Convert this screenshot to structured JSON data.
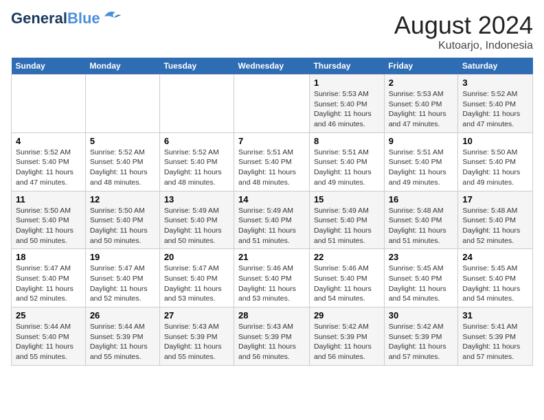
{
  "header": {
    "logo_line1": "General",
    "logo_line2": "Blue",
    "month_title": "August 2024",
    "location": "Kutoarjo, Indonesia"
  },
  "days_of_week": [
    "Sunday",
    "Monday",
    "Tuesday",
    "Wednesday",
    "Thursday",
    "Friday",
    "Saturday"
  ],
  "weeks": [
    [
      {
        "day": "",
        "info": ""
      },
      {
        "day": "",
        "info": ""
      },
      {
        "day": "",
        "info": ""
      },
      {
        "day": "",
        "info": ""
      },
      {
        "day": "1",
        "info": "Sunrise: 5:53 AM\nSunset: 5:40 PM\nDaylight: 11 hours and 46 minutes."
      },
      {
        "day": "2",
        "info": "Sunrise: 5:53 AM\nSunset: 5:40 PM\nDaylight: 11 hours and 47 minutes."
      },
      {
        "day": "3",
        "info": "Sunrise: 5:52 AM\nSunset: 5:40 PM\nDaylight: 11 hours and 47 minutes."
      }
    ],
    [
      {
        "day": "4",
        "info": "Sunrise: 5:52 AM\nSunset: 5:40 PM\nDaylight: 11 hours and 47 minutes."
      },
      {
        "day": "5",
        "info": "Sunrise: 5:52 AM\nSunset: 5:40 PM\nDaylight: 11 hours and 48 minutes."
      },
      {
        "day": "6",
        "info": "Sunrise: 5:52 AM\nSunset: 5:40 PM\nDaylight: 11 hours and 48 minutes."
      },
      {
        "day": "7",
        "info": "Sunrise: 5:51 AM\nSunset: 5:40 PM\nDaylight: 11 hours and 48 minutes."
      },
      {
        "day": "8",
        "info": "Sunrise: 5:51 AM\nSunset: 5:40 PM\nDaylight: 11 hours and 49 minutes."
      },
      {
        "day": "9",
        "info": "Sunrise: 5:51 AM\nSunset: 5:40 PM\nDaylight: 11 hours and 49 minutes."
      },
      {
        "day": "10",
        "info": "Sunrise: 5:50 AM\nSunset: 5:40 PM\nDaylight: 11 hours and 49 minutes."
      }
    ],
    [
      {
        "day": "11",
        "info": "Sunrise: 5:50 AM\nSunset: 5:40 PM\nDaylight: 11 hours and 50 minutes."
      },
      {
        "day": "12",
        "info": "Sunrise: 5:50 AM\nSunset: 5:40 PM\nDaylight: 11 hours and 50 minutes."
      },
      {
        "day": "13",
        "info": "Sunrise: 5:49 AM\nSunset: 5:40 PM\nDaylight: 11 hours and 50 minutes."
      },
      {
        "day": "14",
        "info": "Sunrise: 5:49 AM\nSunset: 5:40 PM\nDaylight: 11 hours and 51 minutes."
      },
      {
        "day": "15",
        "info": "Sunrise: 5:49 AM\nSunset: 5:40 PM\nDaylight: 11 hours and 51 minutes."
      },
      {
        "day": "16",
        "info": "Sunrise: 5:48 AM\nSunset: 5:40 PM\nDaylight: 11 hours and 51 minutes."
      },
      {
        "day": "17",
        "info": "Sunrise: 5:48 AM\nSunset: 5:40 PM\nDaylight: 11 hours and 52 minutes."
      }
    ],
    [
      {
        "day": "18",
        "info": "Sunrise: 5:47 AM\nSunset: 5:40 PM\nDaylight: 11 hours and 52 minutes."
      },
      {
        "day": "19",
        "info": "Sunrise: 5:47 AM\nSunset: 5:40 PM\nDaylight: 11 hours and 52 minutes."
      },
      {
        "day": "20",
        "info": "Sunrise: 5:47 AM\nSunset: 5:40 PM\nDaylight: 11 hours and 53 minutes."
      },
      {
        "day": "21",
        "info": "Sunrise: 5:46 AM\nSunset: 5:40 PM\nDaylight: 11 hours and 53 minutes."
      },
      {
        "day": "22",
        "info": "Sunrise: 5:46 AM\nSunset: 5:40 PM\nDaylight: 11 hours and 54 minutes."
      },
      {
        "day": "23",
        "info": "Sunrise: 5:45 AM\nSunset: 5:40 PM\nDaylight: 11 hours and 54 minutes."
      },
      {
        "day": "24",
        "info": "Sunrise: 5:45 AM\nSunset: 5:40 PM\nDaylight: 11 hours and 54 minutes."
      }
    ],
    [
      {
        "day": "25",
        "info": "Sunrise: 5:44 AM\nSunset: 5:40 PM\nDaylight: 11 hours and 55 minutes."
      },
      {
        "day": "26",
        "info": "Sunrise: 5:44 AM\nSunset: 5:39 PM\nDaylight: 11 hours and 55 minutes."
      },
      {
        "day": "27",
        "info": "Sunrise: 5:43 AM\nSunset: 5:39 PM\nDaylight: 11 hours and 55 minutes."
      },
      {
        "day": "28",
        "info": "Sunrise: 5:43 AM\nSunset: 5:39 PM\nDaylight: 11 hours and 56 minutes."
      },
      {
        "day": "29",
        "info": "Sunrise: 5:42 AM\nSunset: 5:39 PM\nDaylight: 11 hours and 56 minutes."
      },
      {
        "day": "30",
        "info": "Sunrise: 5:42 AM\nSunset: 5:39 PM\nDaylight: 11 hours and 57 minutes."
      },
      {
        "day": "31",
        "info": "Sunrise: 5:41 AM\nSunset: 5:39 PM\nDaylight: 11 hours and 57 minutes."
      }
    ]
  ]
}
